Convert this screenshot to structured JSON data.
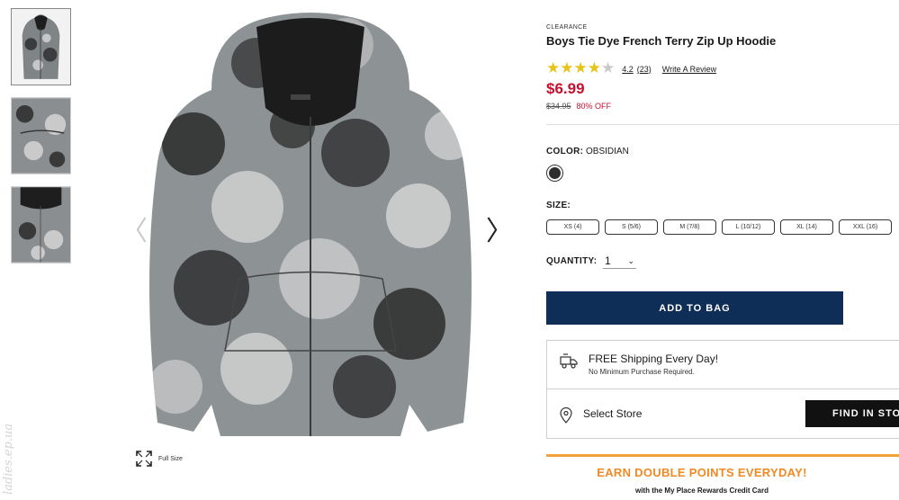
{
  "gallery": {
    "thumbnails": [
      "hoodie-front",
      "hoodie-pocket-detail",
      "hoodie-collar-detail"
    ],
    "main_image": "tie-dye-zip-hoodie",
    "prev_arrow": "〈",
    "next_arrow": "〉",
    "full_size_label": "Full Size"
  },
  "watermark": "ladies.ep.ua",
  "product": {
    "badge": "CLEARANCE",
    "title": "Boys Tie Dye French Terry Zip Up Hoodie",
    "rating": 4.2,
    "rating_text": "4.2",
    "review_count": "(23)",
    "write_review": "Write A Review",
    "price": "$6.99",
    "was_price": "$34.95",
    "discount": "80% OFF"
  },
  "color": {
    "label": "COLOR:",
    "value": "OBSIDIAN",
    "swatch_hex": "#2e2e2e"
  },
  "size": {
    "label": "SIZE:",
    "options": [
      "XS (4)",
      "S (5/6)",
      "M (7/8)",
      "L (10/12)",
      "XL (14)",
      "XXL (16)"
    ]
  },
  "quantity": {
    "label": "QUANTITY:",
    "value": "1"
  },
  "add_to_bag": "ADD TO BAG",
  "shipping": {
    "title": "FREE Shipping Every Day!",
    "subtitle": "No Minimum Purchase Required."
  },
  "store": {
    "label": "Select Store",
    "button": "FIND IN STORE"
  },
  "promo": {
    "headline": "EARN DOUBLE POINTS EVERYDAY!",
    "subline": "with the My Place Rewards Credit Card"
  },
  "colors": {
    "price_red": "#c8102e",
    "navy": "#0f2e57",
    "orange": "#f08a24",
    "star_gold": "#e6c41a"
  }
}
